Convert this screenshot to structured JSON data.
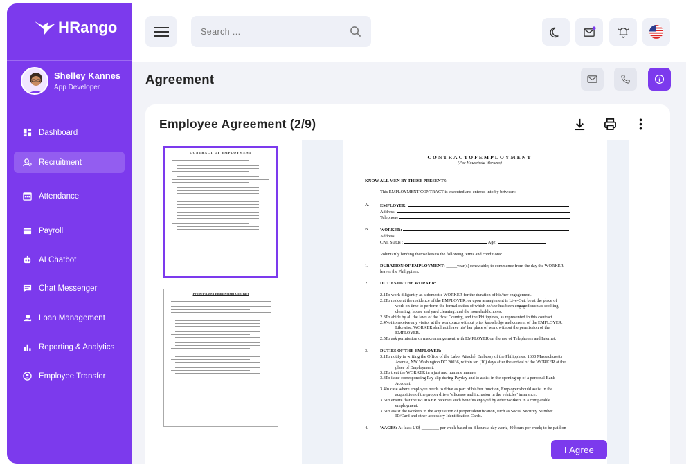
{
  "brand": {
    "name": "HRango"
  },
  "user": {
    "name": "Shelley Kannes",
    "role": "App Developer"
  },
  "nav": [
    {
      "label": "Dashboard",
      "icon": "dashboard-icon"
    },
    {
      "label": "Recruitment",
      "icon": "recruitment-icon",
      "active": true
    },
    {
      "label": "Attendance",
      "icon": "calendar-icon"
    },
    {
      "label": "Payroll",
      "icon": "card-icon"
    },
    {
      "label": "AI Chatbot",
      "icon": "robot-icon"
    },
    {
      "label": "Chat Messenger",
      "icon": "chat-icon"
    },
    {
      "label": "Loan Management",
      "icon": "loan-icon"
    },
    {
      "label": "Reporting & Analytics",
      "icon": "chart-icon"
    },
    {
      "label": "Employee Transfer",
      "icon": "transfer-icon"
    }
  ],
  "search": {
    "placeholder": "Search ..."
  },
  "page": {
    "title": "Agreement"
  },
  "card": {
    "title": "Employee Agreement (2/9)"
  },
  "thumbs": [
    {
      "title": "CONTRACT OF EMPLOYMENT"
    },
    {
      "title": "Project-Based Employment Contract"
    }
  ],
  "doc": {
    "title": "CONTRACTOFEMPLOYMENT",
    "subtitle": "(For Household Workers)",
    "know": "KNOW ALL MEN BY THESE PRESENTS:",
    "intro": "This EMPLOYMENT CONTRACT is executed and entered into by between:",
    "a_label": "A.",
    "employer": "EMPLOYER:",
    "address": "Address",
    "telephone": "Telephone",
    "b_label": "B.",
    "worker": "WORKER:",
    "civil": "Civil Status",
    "age": "Age:",
    "binding": "Voluntarily binding themselves to the following terms and conditions:",
    "s1_num": "1.",
    "s1_head": "DURATION OF EMPLOYMENT",
    "s1_text": ": _____year(s) renewable; to commence from the day the WORKER",
    "s1_text2": "leaves the Philippines.",
    "s2_num": "2.",
    "s2_head": "DUTIES OF THE WORKER:",
    "s2_items": [
      "2.1To work diligently as a domestic WORKER for the duration of his/her engagement.",
      "2.2To reside at the residence of the EMPLOYER, or upon arrangement is Live-Out, be at the place of",
      "work on time to perform the formal duties of which he/she has been engaged such as cooking,",
      "cleaning, house and yard cleaning, and the household chores.",
      "2.3To abide by all the laws of the Host Country, and the Philippines, as represented in this contract.",
      "2.4Not to receive any visitor at the workplace without prior knowledge and consent of the EMPLOYER.",
      "Likewise, WORKER shall not leave his/ her place of work without the permission of the",
      "EMPLOYER.",
      "2.5To ask permission or make arrangement with EMPLOYER on the use of Telephones and Internet."
    ],
    "s3_num": "3.",
    "s3_head": "DUTIES OF THE EMPLOYER:",
    "s3_items": [
      "3.1To notify in writing the Office of the Labor Attaché, Embassy of the Philippines, 1600 Massachusetts",
      "Avenue, NW Washington DC 20036, within ten (10) days after the arrival of the WORKER at the",
      "place of Employment.",
      "3.2To treat the WORKER in a just and humane manner",
      "3.3To issue corresponding Pay slip during Payday and to assist in the opening up of a personal Bank",
      "Account.",
      "3.4In case where employee needs to drive as part of his/her function, Employer should assist in the",
      "acquisition of the proper driver’s license and inclusion in the vehicles’ insurance.",
      "3.5To ensure that the WORKER receives such benefits enjoyed by other workers in a comparable",
      "employment.",
      "3.6To assist the workers in the acquisition of proper identification, such as Social Security Number",
      "ID/Card and other accessory Identification Cards."
    ],
    "s4_num": "4.",
    "s4_head": "WAGES:",
    "s4_text": "At least US$ ________ per week based on 8 hours a day work, 40 hours per week; to be paid on"
  },
  "actions": {
    "agree": "I Agree"
  },
  "colors": {
    "primary": "#7c3aed",
    "surface": "#eef0f7"
  }
}
